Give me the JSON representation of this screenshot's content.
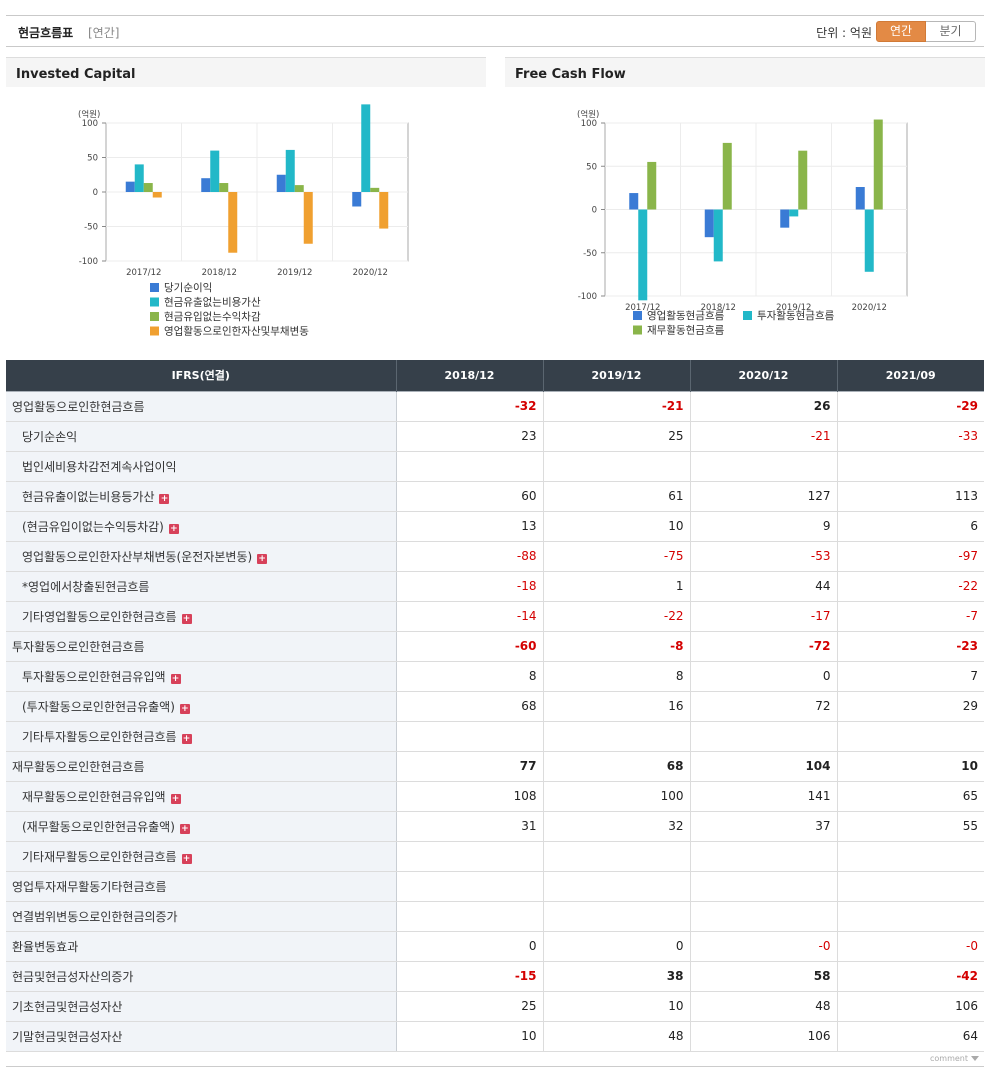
{
  "header": {
    "title": "현금흐름표",
    "subtitle": "[연간]",
    "unit": "단위 : 억원",
    "btn_annual": "연간",
    "btn_quarter": "분기"
  },
  "chart_data": [
    {
      "type": "bar",
      "panel_title": "Invested Capital",
      "unit_label": "(억원)",
      "categories": [
        "2017/12",
        "2018/12",
        "2019/12",
        "2020/12"
      ],
      "ylim": [
        -100,
        100
      ],
      "yticks": [
        100,
        50,
        0,
        -50,
        -100
      ],
      "series": [
        {
          "name": "당기순이익",
          "color": "#3a7bd5",
          "values": [
            15,
            20,
            25,
            -21
          ]
        },
        {
          "name": "현금유출없는비용가산",
          "color": "#22b8c8",
          "values": [
            40,
            60,
            61,
            127
          ]
        },
        {
          "name": "현금유입없는수익차감",
          "color": "#8ab54a",
          "values": [
            13,
            13,
            10,
            6
          ]
        },
        {
          "name": "영업활동으로인한자산및부채변동",
          "color": "#f0a030",
          "values": [
            -8,
            -88,
            -75,
            -53
          ]
        }
      ],
      "legend_columns": 1
    },
    {
      "type": "bar",
      "panel_title": "Free Cash Flow",
      "unit_label": "(억원)",
      "categories": [
        "2017/12",
        "2018/12",
        "2019/12",
        "2020/12"
      ],
      "ylim": [
        -100,
        100
      ],
      "yticks": [
        100,
        50,
        0,
        -50,
        -100
      ],
      "series": [
        {
          "name": "영업활동현금흐름",
          "color": "#3a7bd5",
          "values": [
            19,
            -32,
            -21,
            26
          ]
        },
        {
          "name": "투자활동현금흐름",
          "color": "#22b8c8",
          "values": [
            -105,
            -60,
            -8,
            -72
          ]
        },
        {
          "name": "재무활동현금흐름",
          "color": "#8ab54a",
          "values": [
            55,
            77,
            68,
            104
          ]
        }
      ],
      "legend_columns": 2
    }
  ],
  "table": {
    "head": [
      "IFRS(연결)",
      "2018/12",
      "2019/12",
      "2020/12",
      "2021/09"
    ],
    "rows": [
      {
        "label": "영업활동으로인한현금흐름",
        "indent": false,
        "major": true,
        "plus": false,
        "values": [
          "-32",
          "-21",
          "26",
          "-29"
        ]
      },
      {
        "label": "당기순손익",
        "indent": true,
        "major": false,
        "plus": false,
        "values": [
          "23",
          "25",
          "-21",
          "-33"
        ]
      },
      {
        "label": "법인세비용차감전계속사업이익",
        "indent": true,
        "major": false,
        "plus": false,
        "values": [
          "",
          "",
          "",
          ""
        ]
      },
      {
        "label": "현금유출이없는비용등가산",
        "indent": true,
        "major": false,
        "plus": true,
        "values": [
          "60",
          "61",
          "127",
          "113"
        ]
      },
      {
        "label": "(현금유입이없는수익등차감)",
        "indent": true,
        "major": false,
        "plus": true,
        "values": [
          "13",
          "10",
          "9",
          "6"
        ]
      },
      {
        "label": "영업활동으로인한자산부채변동(운전자본변동)",
        "indent": true,
        "major": false,
        "plus": true,
        "values": [
          "-88",
          "-75",
          "-53",
          "-97"
        ]
      },
      {
        "label": "*영업에서창출된현금흐름",
        "indent": true,
        "major": false,
        "plus": false,
        "values": [
          "-18",
          "1",
          "44",
          "-22"
        ]
      },
      {
        "label": "기타영업활동으로인한현금흐름",
        "indent": true,
        "major": false,
        "plus": true,
        "values": [
          "-14",
          "-22",
          "-17",
          "-7"
        ]
      },
      {
        "label": "투자활동으로인한현금흐름",
        "indent": false,
        "major": true,
        "plus": false,
        "values": [
          "-60",
          "-8",
          "-72",
          "-23"
        ]
      },
      {
        "label": "투자활동으로인한현금유입액",
        "indent": true,
        "major": false,
        "plus": true,
        "values": [
          "8",
          "8",
          "0",
          "7"
        ]
      },
      {
        "label": "(투자활동으로인한현금유출액)",
        "indent": true,
        "major": false,
        "plus": true,
        "values": [
          "68",
          "16",
          "72",
          "29"
        ]
      },
      {
        "label": "기타투자활동으로인한현금흐름",
        "indent": true,
        "major": false,
        "plus": true,
        "values": [
          "",
          "",
          "",
          ""
        ]
      },
      {
        "label": "재무활동으로인한현금흐름",
        "indent": false,
        "major": true,
        "plus": false,
        "values": [
          "77",
          "68",
          "104",
          "10"
        ]
      },
      {
        "label": "재무활동으로인한현금유입액",
        "indent": true,
        "major": false,
        "plus": true,
        "values": [
          "108",
          "100",
          "141",
          "65"
        ]
      },
      {
        "label": "(재무활동으로인한현금유출액)",
        "indent": true,
        "major": false,
        "plus": true,
        "values": [
          "31",
          "32",
          "37",
          "55"
        ]
      },
      {
        "label": "기타재무활동으로인한현금흐름",
        "indent": true,
        "major": false,
        "plus": true,
        "values": [
          "",
          "",
          "",
          ""
        ]
      },
      {
        "label": "영업투자재무활동기타현금흐름",
        "indent": false,
        "major": false,
        "plus": false,
        "values": [
          "",
          "",
          "",
          ""
        ]
      },
      {
        "label": "연결범위변동으로인한현금의증가",
        "indent": false,
        "major": false,
        "plus": false,
        "values": [
          "",
          "",
          "",
          ""
        ]
      },
      {
        "label": "환율변동효과",
        "indent": false,
        "major": false,
        "plus": false,
        "values": [
          "0",
          "0",
          "-0",
          "-0"
        ]
      },
      {
        "label": "현금및현금성자산의증가",
        "indent": false,
        "major": true,
        "plus": false,
        "values": [
          "-15",
          "38",
          "58",
          "-42"
        ]
      },
      {
        "label": "기초현금및현금성자산",
        "indent": false,
        "major": false,
        "plus": false,
        "values": [
          "25",
          "10",
          "48",
          "106"
        ]
      },
      {
        "label": "기말현금및현금성자산",
        "indent": false,
        "major": false,
        "plus": false,
        "values": [
          "10",
          "48",
          "106",
          "64"
        ]
      }
    ]
  },
  "footer": {
    "comment": "comment"
  }
}
